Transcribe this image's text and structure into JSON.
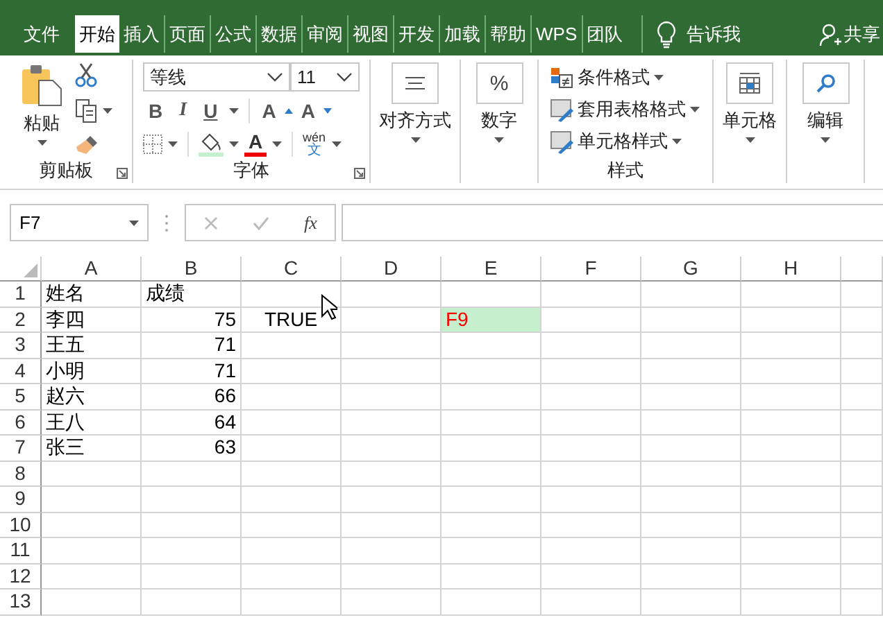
{
  "tabs": [
    {
      "label": "文件",
      "selected": false
    },
    {
      "label": "开始",
      "selected": true
    },
    {
      "label": "插入",
      "selected": false
    },
    {
      "label": "页面",
      "selected": false
    },
    {
      "label": "公式",
      "selected": false
    },
    {
      "label": "数据",
      "selected": false
    },
    {
      "label": "审阅",
      "selected": false
    },
    {
      "label": "视图",
      "selected": false
    },
    {
      "label": "开发",
      "selected": false
    },
    {
      "label": "加载",
      "selected": false
    },
    {
      "label": "帮助",
      "selected": false
    },
    {
      "label": "WPS",
      "selected": false
    },
    {
      "label": "团队",
      "selected": false
    }
  ],
  "tell_me": "告诉我",
  "share": "共享",
  "ribbon": {
    "clipboard": {
      "paste": "粘贴",
      "label": "剪贴板"
    },
    "font": {
      "name": "等线",
      "size": "11",
      "style_buttons": [
        "B",
        "I",
        "U"
      ],
      "size_buttons": [
        "A",
        "A"
      ],
      "font_color": "A",
      "phonetic": [
        "wén",
        "文"
      ],
      "label": "字体"
    },
    "alignment": "对齐方式",
    "number": {
      "symbol": "%",
      "label": "数字"
    },
    "styles": {
      "items": [
        "条件格式",
        "套用表格格式",
        "单元格样式"
      ],
      "label": "样式"
    },
    "cells": "单元格",
    "editing": "编辑"
  },
  "formula_bar": {
    "name_box": "F7",
    "fx": "fx"
  },
  "sheet": {
    "columns": [
      "A",
      "B",
      "C",
      "D",
      "E",
      "F",
      "G",
      "H"
    ],
    "rows": [
      {
        "header": "1",
        "cells": [
          {
            "text": "姓名",
            "kind": "text",
            "highlight": false
          },
          {
            "text": "成绩",
            "kind": "text",
            "highlight": false
          }
        ]
      },
      {
        "header": "2",
        "cells": [
          {
            "text": "李四",
            "kind": "text",
            "highlight": false
          },
          {
            "text": "75",
            "kind": "number",
            "highlight": false
          },
          {
            "text": "TRUE",
            "kind": "bool",
            "highlight": false
          },
          null,
          {
            "text": "F9",
            "kind": "text",
            "highlight": true
          }
        ]
      },
      {
        "header": "3",
        "cells": [
          {
            "text": "王五",
            "kind": "text",
            "highlight": false
          },
          {
            "text": "71",
            "kind": "number",
            "highlight": false
          }
        ]
      },
      {
        "header": "4",
        "cells": [
          {
            "text": "小明",
            "kind": "text",
            "highlight": false
          },
          {
            "text": "71",
            "kind": "number",
            "highlight": false
          }
        ]
      },
      {
        "header": "5",
        "cells": [
          {
            "text": "赵六",
            "kind": "text",
            "highlight": false
          },
          {
            "text": "66",
            "kind": "number",
            "highlight": false
          }
        ]
      },
      {
        "header": "6",
        "cells": [
          {
            "text": "王八",
            "kind": "text",
            "highlight": false
          },
          {
            "text": "64",
            "kind": "number",
            "highlight": false
          }
        ]
      },
      {
        "header": "7",
        "cells": [
          {
            "text": "张三",
            "kind": "text",
            "highlight": false
          },
          {
            "text": "63",
            "kind": "number",
            "highlight": false
          }
        ]
      },
      {
        "header": "8",
        "cells": []
      },
      {
        "header": "9",
        "cells": []
      },
      {
        "header": "10",
        "cells": []
      },
      {
        "header": "11",
        "cells": []
      },
      {
        "header": "12",
        "cells": []
      },
      {
        "header": "13",
        "cells": []
      }
    ]
  }
}
